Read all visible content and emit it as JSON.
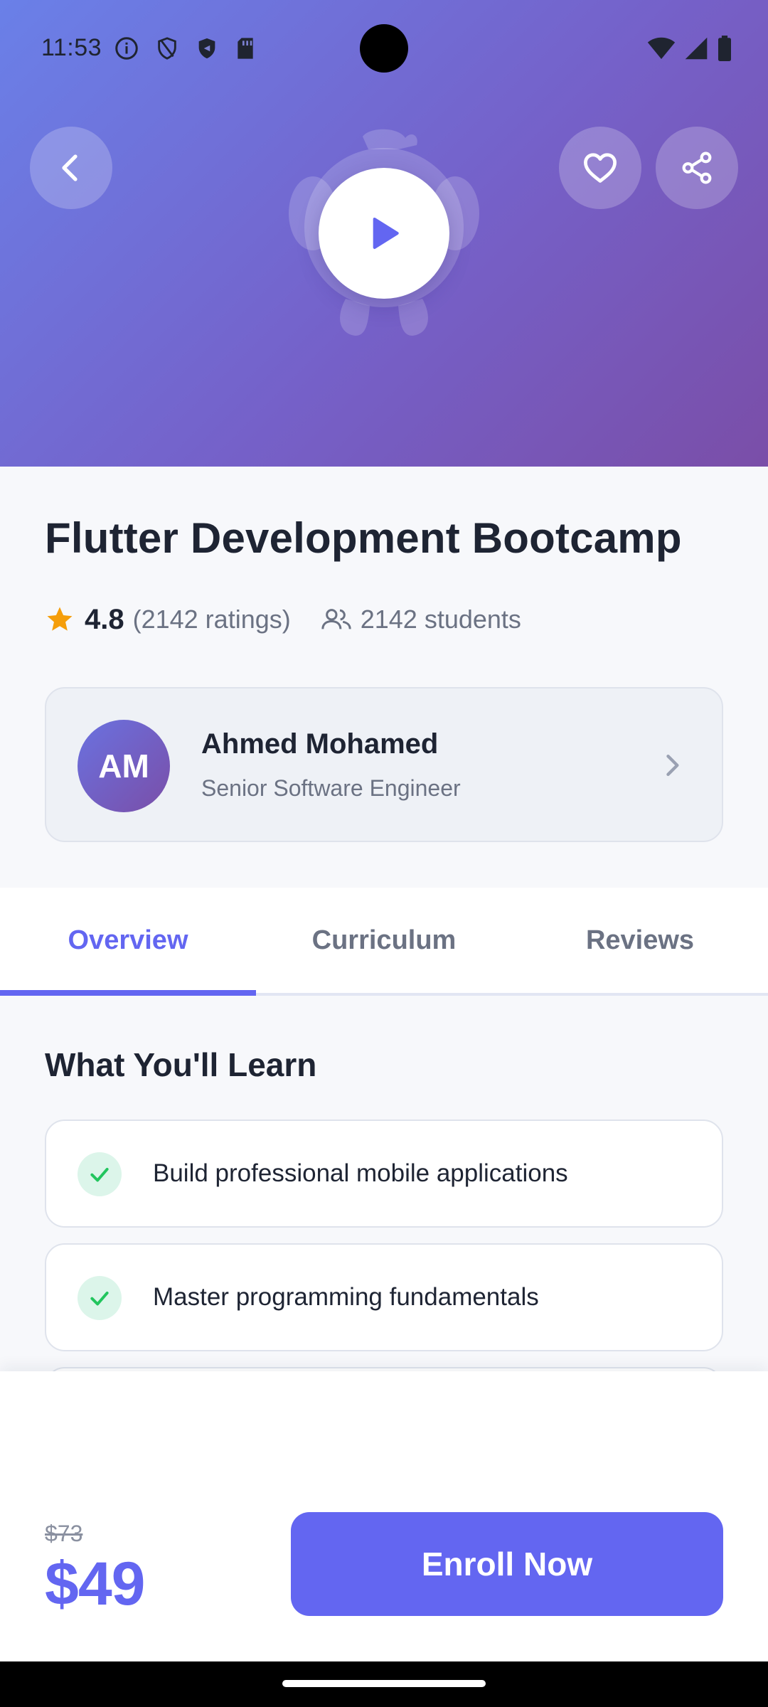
{
  "status_bar": {
    "time": "11:53",
    "left_icons": [
      "info-icon",
      "shield-outline-icon",
      "shield-filled-icon",
      "sd-card-icon"
    ],
    "right_icons": [
      "wifi-icon",
      "signal-icon",
      "battery-icon"
    ]
  },
  "hero": {
    "colors": {
      "gradient_start": "#6a80e8",
      "gradient_end": "#7a4ea8"
    },
    "actions": {
      "back": "arrow-left-icon",
      "favorite": "heart-icon",
      "share": "share-icon",
      "play": "play-icon"
    }
  },
  "course": {
    "title": "Flutter Development Bootcamp",
    "rating": "4.8",
    "ratings_count": "(2142 ratings)",
    "students": "2142 students"
  },
  "instructor": {
    "initials": "AM",
    "name": "Ahmed Mohamed",
    "role": "Senior Software Engineer"
  },
  "tabs": [
    {
      "label": "Overview",
      "active": true
    },
    {
      "label": "Curriculum",
      "active": false
    },
    {
      "label": "Reviews",
      "active": false
    }
  ],
  "learn": {
    "title": "What You'll Learn",
    "items": [
      "Build professional mobile applications",
      "Master programming fundamentals"
    ]
  },
  "pricing": {
    "old_price": "$73",
    "new_price": "$49",
    "enroll_label": "Enroll Now"
  },
  "theme": {
    "accent": "#6366f1",
    "success": "#22c55e",
    "star": "#f59e0b"
  }
}
